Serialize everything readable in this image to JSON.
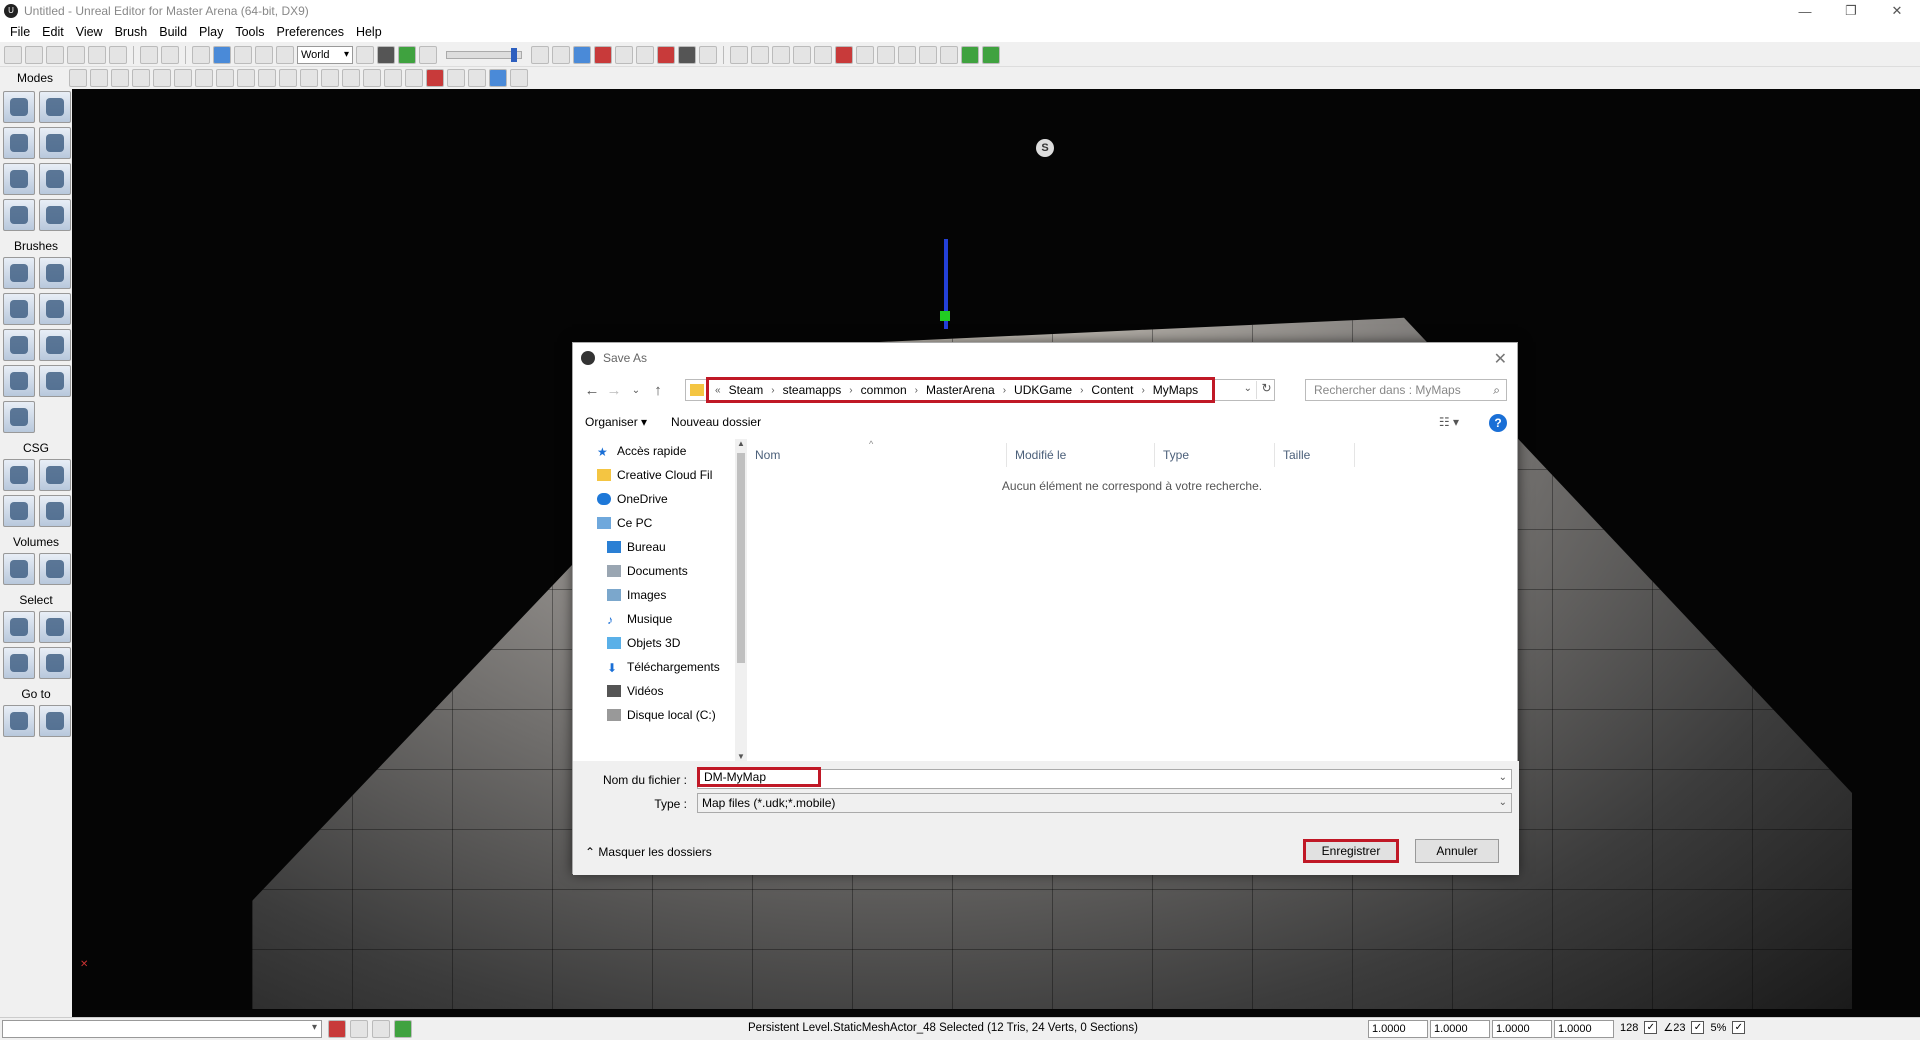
{
  "window": {
    "title": "Untitled - Unreal Editor for Master Arena (64-bit, DX9)",
    "controls": [
      "—",
      "❐",
      "✕"
    ]
  },
  "menu": [
    "File",
    "Edit",
    "View",
    "Brush",
    "Build",
    "Play",
    "Tools",
    "Preferences",
    "Help"
  ],
  "toolbar": {
    "coord_system": "World",
    "modes_label": "Modes"
  },
  "left_panel": {
    "sections": [
      {
        "title": "",
        "buttons": 8
      },
      {
        "title": "Brushes",
        "buttons": 9
      },
      {
        "title": "CSG",
        "buttons": 4
      },
      {
        "title": "Volumes",
        "buttons": 2
      },
      {
        "title": "Select",
        "buttons": 4
      },
      {
        "title": "Go to",
        "buttons": 2
      }
    ]
  },
  "viewport": {
    "light_label": "S"
  },
  "dialog": {
    "title": "Save As",
    "breadcrumbs": [
      "Steam",
      "steamapps",
      "common",
      "MasterArena",
      "UDKGame",
      "Content",
      "MyMaps"
    ],
    "breadcrumb_prefix": "«",
    "search_placeholder": "Rechercher dans : MyMaps",
    "organize": "Organiser ▾",
    "new_folder": "Nouveau dossier",
    "nav_items": [
      {
        "label": "Accès rapide",
        "icon": "star-icon",
        "level": 1
      },
      {
        "label": "Creative Cloud Fil",
        "icon": "cloud-folder-icon",
        "level": 1
      },
      {
        "label": "OneDrive",
        "icon": "onedrive-icon",
        "level": 1
      },
      {
        "label": "Ce PC",
        "icon": "pc-icon",
        "level": 1
      },
      {
        "label": "Bureau",
        "icon": "desktop-icon",
        "level": 2
      },
      {
        "label": "Documents",
        "icon": "documents-icon",
        "level": 2
      },
      {
        "label": "Images",
        "icon": "images-icon",
        "level": 2
      },
      {
        "label": "Musique",
        "icon": "music-icon",
        "level": 2
      },
      {
        "label": "Objets 3D",
        "icon": "objects-3d-icon",
        "level": 2
      },
      {
        "label": "Téléchargements",
        "icon": "download-icon",
        "level": 2
      },
      {
        "label": "Vidéos",
        "icon": "videos-icon",
        "level": 2
      },
      {
        "label": "Disque local (C:)",
        "icon": "disk-icon",
        "level": 2
      }
    ],
    "columns": [
      "Nom",
      "Modifié le",
      "Type",
      "Taille"
    ],
    "empty_message": "Aucun élément ne correspond à votre recherche.",
    "filename_label": "Nom du fichier :",
    "filename_value": "DM-MyMap",
    "type_label": "Type :",
    "type_value": "Map files (*.udk;*.mobile)",
    "hide_folders": "Masquer les dossiers",
    "save_button": "Enregistrer",
    "cancel_button": "Annuler",
    "highlight_color": "#c01826"
  },
  "statusbar": {
    "selection_text": "Persistent Level.StaticMeshActor_48 Selected (12 Tris, 24 Verts, 0 Sections)",
    "values": [
      "1.0000",
      "1.0000",
      "1.0000",
      "1.0000"
    ],
    "grid": "128",
    "angle": "∠23",
    "percent": "5%"
  }
}
